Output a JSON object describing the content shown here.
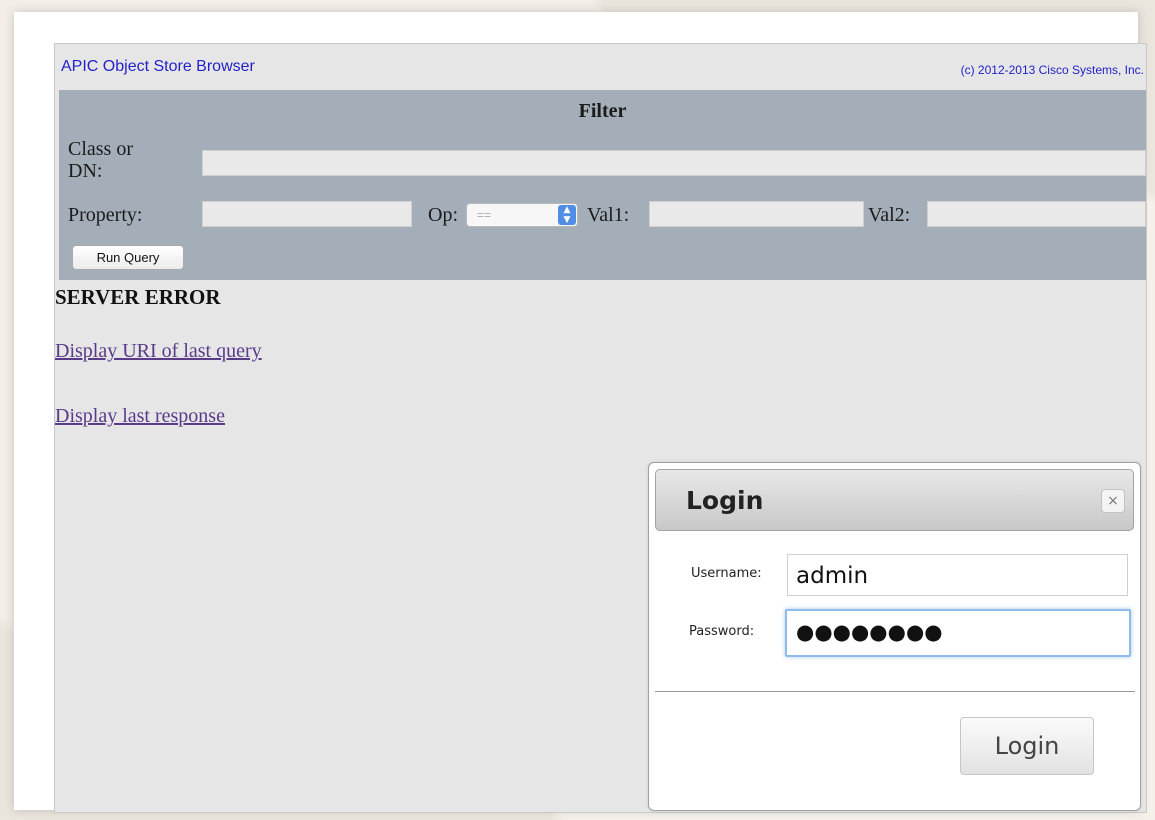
{
  "header": {
    "app_title": "APIC Object Store Browser",
    "copyright": "(c) 2012-2013 Cisco Systems, Inc."
  },
  "filter": {
    "title": "Filter",
    "class_or_dn_label_line1": "Class or",
    "class_or_dn_label_line2": "DN:",
    "class_or_dn_value": "",
    "property_label": "Property:",
    "property_value": "",
    "op_label": "Op:",
    "op_selected": "==",
    "val1_label": "Val1:",
    "val1_value": "",
    "val2_label": "Val2:",
    "val2_value": "",
    "run_query_label": "Run Query"
  },
  "results": {
    "status": "SERVER ERROR",
    "link_last_query": "Display URI of last query",
    "link_last_response": "Display last response"
  },
  "login_dialog": {
    "title": "Login",
    "close_symbol": "×",
    "username_label": "Username:",
    "username_value": "admin",
    "password_label": "Password:",
    "password_value": "●●●●●●●●",
    "submit_label": "Login"
  },
  "colors": {
    "link_blue": "#2323c8",
    "visited_link": "#5a3b8a",
    "filter_panel": "#a4aeb9",
    "focus_ring": "#8ebbe8"
  }
}
